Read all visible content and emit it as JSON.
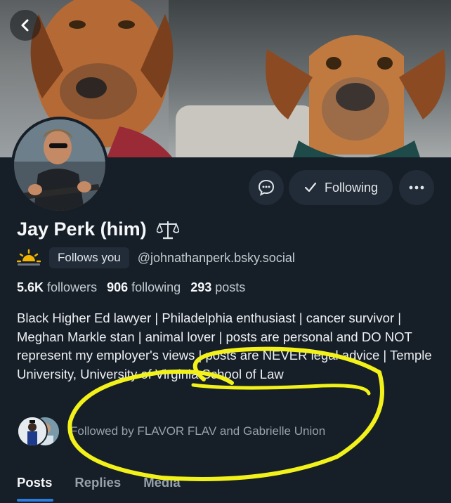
{
  "header": {
    "back_icon": "chevron-left-icon"
  },
  "profile": {
    "name": "Jay Perk (him)",
    "name_emoji": "⚖",
    "status_emoji": "🌅",
    "follows_you_label": "Follows you",
    "handle": "@johnathanperk.bsky.social",
    "stats": {
      "followers_count": "5.6K",
      "followers_label": "followers",
      "following_count": "906",
      "following_label": "following",
      "posts_count": "293",
      "posts_label": "posts"
    },
    "bio": "Black Higher Ed lawyer | Philadelphia enthusiast | cancer survivor | Meghan Markle stan | animal lover | posts are personal and DO NOT represent my employer's views | posts are NEVER legal advice | Temple University, University of Virginia School of Law",
    "followed_by": "Followed by FLAVOR FLAV and Gabrielle Union"
  },
  "actions": {
    "message_icon": "chat-bubble-icon",
    "following_label": "Following",
    "more_icon": "ellipsis-icon"
  },
  "tabs": [
    {
      "label": "Posts",
      "active": true
    },
    {
      "label": "Replies",
      "active": false
    },
    {
      "label": "Media",
      "active": false
    }
  ],
  "colors": {
    "background": "#161e27",
    "button": "#222c38",
    "accent": "#2a7dde",
    "annotation": "#f2f21a"
  }
}
